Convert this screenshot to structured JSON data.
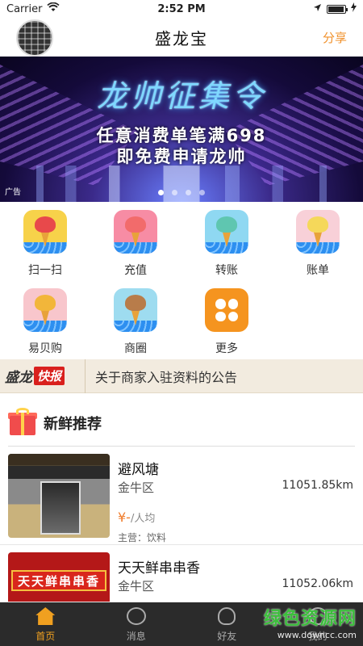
{
  "status_bar": {
    "carrier": "Carrier",
    "time": "2:52 PM",
    "battery_level": 0.95
  },
  "nav": {
    "title": "盛龙宝",
    "share_label": "分享"
  },
  "banner": {
    "title": "龙帅征集令",
    "line1": "任意消费单笔满698",
    "line2": "即免费申请龙帅",
    "ad_tag": "广告",
    "dots": 4,
    "active_dot": 0
  },
  "grid": [
    {
      "label": "扫一扫",
      "icon": "scan-icon",
      "bg": "#f7d24a",
      "scoop": "#e8494b"
    },
    {
      "label": "充值",
      "icon": "recharge-icon",
      "bg": "#f78ca4",
      "scoop": "#f26b6b"
    },
    {
      "label": "转账",
      "icon": "transfer-icon",
      "bg": "#8fd8f2",
      "scoop": "#5fc6b0"
    },
    {
      "label": "账单",
      "icon": "bill-icon",
      "bg": "#f8d0d8",
      "scoop": "#f5d85a"
    },
    {
      "label": "易贝购",
      "icon": "shop-icon",
      "bg": "#f8c6cc",
      "scoop": "#f2b63a"
    },
    {
      "label": "商圈",
      "icon": "business-circle-icon",
      "bg": "#9edcf0",
      "scoop": "#b87c4a"
    },
    {
      "label": "更多",
      "icon": "more-icon",
      "bg": "#f5941f",
      "scoop": ""
    }
  ],
  "news": {
    "logo_a": "盛龙",
    "logo_b": "快报",
    "text": "关于商家入驻资料的公告"
  },
  "section": {
    "title": "新鲜推荐"
  },
  "shops": [
    {
      "name": "避风塘",
      "area": "金牛区",
      "distance": "11051.85km",
      "price": "¥-",
      "price_unit": "/人均",
      "main": "主营：饮料"
    },
    {
      "name": "天天鲜串串香",
      "area": "金牛区",
      "distance": "11052.06km",
      "sign": "天天鲜串串香"
    }
  ],
  "tabs": [
    {
      "label": "首页",
      "icon": "home-icon",
      "active": true
    },
    {
      "label": "消息",
      "icon": "message-icon",
      "active": false
    },
    {
      "label": "好友",
      "icon": "friends-icon",
      "active": false
    },
    {
      "label": "我的",
      "icon": "profile-icon",
      "active": false
    }
  ],
  "watermark": {
    "line1": "绿色资源网",
    "line2": "www.downcc.com"
  }
}
